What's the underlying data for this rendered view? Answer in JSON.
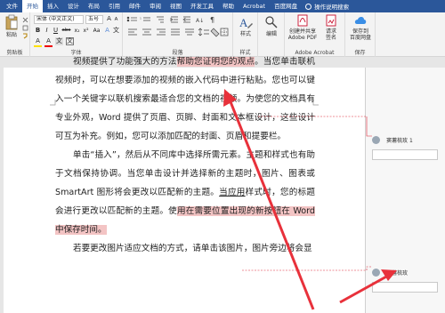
{
  "tabs": [
    "文件",
    "开始",
    "插入",
    "设计",
    "布局",
    "引用",
    "邮件",
    "审阅",
    "视图",
    "开发工具",
    "帮助",
    "Acrobat",
    "百度网盘"
  ],
  "active_tab": "开始",
  "tell_me": "操作说明搜索",
  "ribbon": {
    "clipboard": {
      "paste": "粘贴",
      "label": "剪贴板"
    },
    "font": {
      "font_name": "宋体 (中文正文)",
      "font_size": "五号",
      "label": "字体",
      "bold": "B",
      "italic": "I",
      "underline": "U",
      "strike": "abc",
      "sub": "x₂",
      "sup": "x²",
      "font_color": "A",
      "highlight": "A",
      "grow": "A",
      "shrink": "A",
      "wen": "文",
      "case": "Aa",
      "clear": "A"
    },
    "paragraph": {
      "label": "段落"
    },
    "styles": {
      "button": "样式",
      "label": "样式"
    },
    "editing": {
      "button": "编辑"
    },
    "adobe": {
      "create_share": "创建并共享",
      "adobe_pdf": "Adobe PDF",
      "request_sign": "请求",
      "sign": "签名",
      "label": "Adobe Acrobat"
    },
    "save": {
      "save_to": "保存到",
      "baidu": "百度网盘",
      "label": "保存"
    }
  },
  "document": {
    "p1": {
      "a": "视频提供了功能强大的方法",
      "b": "帮助您证明您的观点",
      "c": "。当您单击联机视频时，可以在想要添加的视频的嵌入代码中进行粘贴。您也可以键入一个关键字以联机搜索最适合您的文档的视频。为使您的文档具有专业外观，Word 提供了页眉、页脚、封面和文本框设计，这些设计可互为补充。例如，您可以添加匹配的封面、页眉和提要栏。"
    },
    "p2": {
      "a": "单击“插入”，然后从不同库中选择所需元素。主题和样式也有助于文档保持协调。当您单击设计并选择新的主题时，图片、图表或 SmartArt 图形将会更改以匹配新的主题。",
      "b": "当应用",
      "c": "样式时，您的标题会进行更改以匹配新的主题。使",
      "d": "用在需要位置出现的新按钮在 Word 中保存时间。"
    },
    "p3": "若要更改图片适应文档的方式，请单击该图片，图片旁边将会显"
  },
  "comments": [
    {
      "author": "窦薯梳玫 1"
    },
    {
      "author": "窦薯梳玫"
    }
  ],
  "colors": {
    "ribbon_blue": "#2b579a",
    "highlight": "#f3c4c4",
    "arrow": "#e8313b"
  }
}
